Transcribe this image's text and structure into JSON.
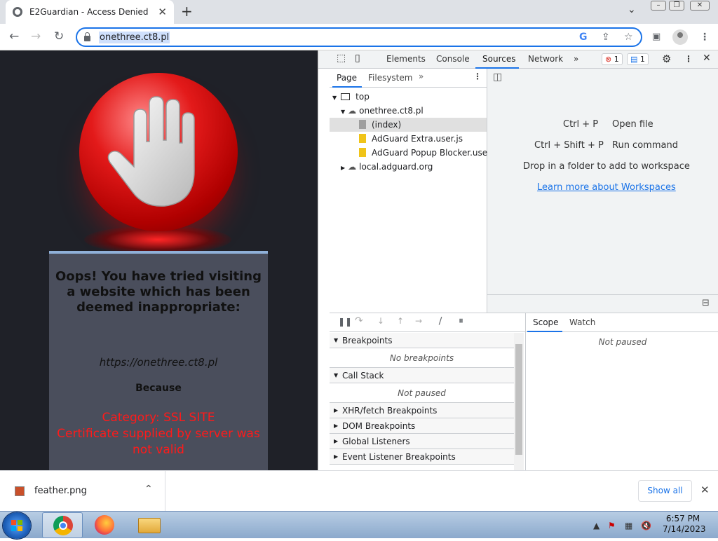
{
  "browser": {
    "tab_title": "E2Guardian - Access Denied",
    "url": "onethree.ct8.pl"
  },
  "page": {
    "heading": "Oops! You have tried visiting a website which has been deemed inappropriate:",
    "blocked_url": "https://onethree.ct8.pl",
    "because": "Because",
    "reason_line1": "Category: SSL SITE",
    "reason_line2": "Certificate supplied by server was not valid"
  },
  "devtools": {
    "tabs": [
      "Elements",
      "Console",
      "Sources",
      "Network"
    ],
    "error_count": "1",
    "message_count": "1",
    "navigator_tabs": [
      "Page",
      "Filesystem"
    ],
    "tree": {
      "top": "top",
      "domain": "onethree.ct8.pl",
      "index": "(index)",
      "file1": "AdGuard Extra.user.js",
      "file2": "AdGuard Popup Blocker.user.js",
      "other_domain": "local.adguard.org"
    },
    "editor": {
      "shortcut1_key": "Ctrl + P",
      "shortcut1_label": "Open file",
      "shortcut2_key": "Ctrl + Shift + P",
      "shortcut2_label": "Run command",
      "drop_text": "Drop in a folder to add to workspace",
      "learn_more": "Learn more about Workspaces"
    },
    "sections": {
      "breakpoints": "Breakpoints",
      "no_breakpoints": "No breakpoints",
      "call_stack": "Call Stack",
      "not_paused": "Not paused",
      "xhr": "XHR/fetch Breakpoints",
      "dom": "DOM Breakpoints",
      "global": "Global Listeners",
      "event": "Event Listener Breakpoints"
    },
    "scope_tabs": [
      "Scope",
      "Watch"
    ],
    "scope_status": "Not paused"
  },
  "downloads": {
    "file_name": "feather.png",
    "show_all": "Show all"
  },
  "taskbar": {
    "time": "6:57 PM",
    "date": "7/14/2023"
  }
}
